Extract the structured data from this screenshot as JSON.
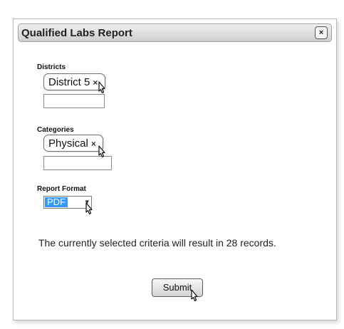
{
  "dialog": {
    "title": "Qualified Labs Report",
    "close_label": "×"
  },
  "districts": {
    "label": "Districts",
    "selected": [
      "District 5"
    ],
    "remove_glyph": "×"
  },
  "categories": {
    "label": "Categories",
    "selected": [
      "Physical"
    ],
    "remove_glyph": "×"
  },
  "report_format": {
    "label": "Report Format",
    "value": "PDF",
    "arrow_glyph": "▾"
  },
  "info": {
    "text": "The currently selected criteria will result in 28 records."
  },
  "submit": {
    "label": "Submit"
  },
  "colors": {
    "selection_highlight": "#3399ff"
  },
  "icons": {
    "close": "close-icon",
    "remove": "remove-x-icon",
    "dropdown": "chevron-down-icon",
    "cursor": "mouse-pointer-icon"
  }
}
